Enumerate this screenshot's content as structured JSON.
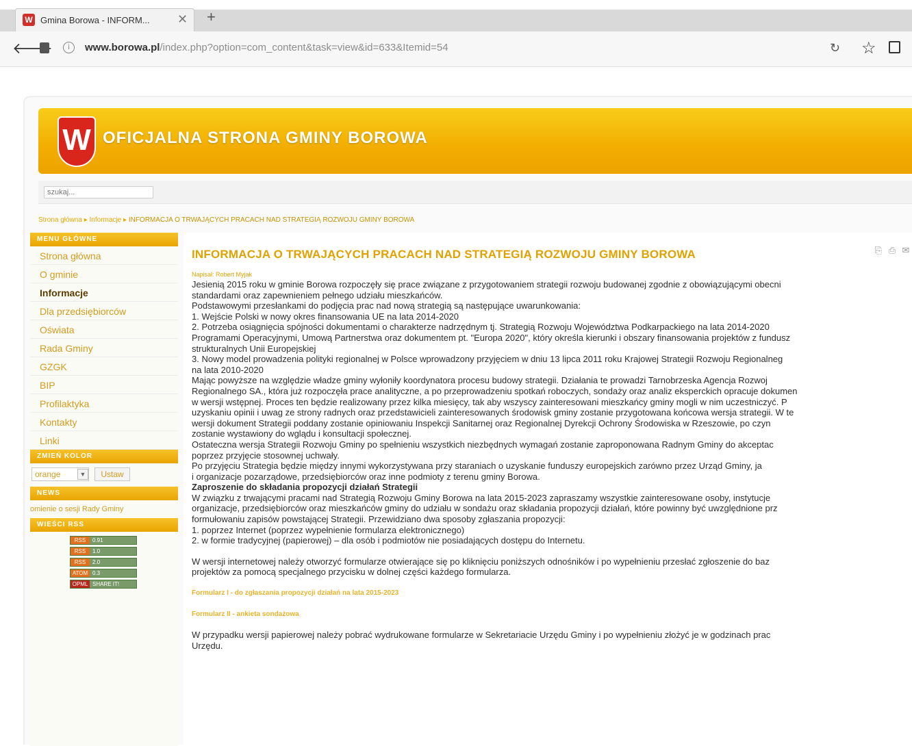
{
  "browser": {
    "tab_title": "Gmina Borowa - INFORM...",
    "url_domain": "www.borowa.pl",
    "url_path": "/index.php?option=com_content&task=view&id=633&Itemid=54",
    "icons": [
      "close-icon",
      "plus-icon",
      "back-arrow-icon",
      "page-icon",
      "info-icon",
      "reload-icon",
      "star-icon",
      "reader-icon"
    ]
  },
  "header": {
    "logo_letter": "W",
    "site_title": "OFICJALNA STRONA GMINY BOROWA",
    "accent_color": "#f2ad00",
    "crest_color": "#d9261c"
  },
  "search": {
    "placeholder": "szukaj..."
  },
  "breadcrumb": {
    "home": "Strona główna",
    "section": "Informacje",
    "current": "INFORMACJA O TRWAJĄCYCH PRACACH NAD STRATEGIĄ ROZWOJU GMINY BOROWA"
  },
  "sidebar": {
    "menu_heading": "MENU GŁÓWNE",
    "menu": [
      "Strona główna",
      "O gminie",
      "Informacje",
      "Dla przedsiębiorców",
      "Oświata",
      "Rada Gminy",
      "GZGK",
      "BIP",
      "Profilaktyka",
      "Kontakty",
      "Linki"
    ],
    "active_item": "Informacje",
    "color_heading": "ZMIEŃ KOLOR",
    "color_value": "orange",
    "color_button": "Ustaw",
    "news_heading": "NEWS",
    "news_link": "omienie o sesji Rady Gminy",
    "rss_heading": "WIEŚCI RSS",
    "rss_badges": [
      {
        "left": "RSS",
        "right": "0.91"
      },
      {
        "left": "RSS",
        "right": "1.0"
      },
      {
        "left": "RSS",
        "right": "2.0"
      },
      {
        "left": "ATOM",
        "right": "0.3"
      },
      {
        "left": "OPML",
        "right": "SHARE IT!"
      }
    ]
  },
  "article": {
    "title": "INFORMACJA O TRWAJĄCYCH PRACACH NAD STRATEGIĄ ROZWOJU GMINY BOROWA",
    "author": "Napisał: Robert Myjak",
    "lines": [
      "Jesienią 2015 roku w gminie Borowa rozpoczęły się prace związane z przygotowaniem strategii rozwoju budowanej zgodnie z obowiązującymi obecni",
      "standardami oraz zapewnieniem pełnego udziału mieszkańców.",
      "Podstawowymi przesłankami do podjęcia prac nad nową strategią są następujące uwarunkowania:",
      "1. Wejście Polski w nowy okres finansowania UE na lata 2014-2020",
      "2. Potrzeba osiągnięcia spójności dokumentami o charakterze nadrzędnym tj. Strategią Rozwoju Województwa Podkarpackiego na lata 2014-2020",
      "Programami Operacyjnymi, Umową Partnerstwa oraz dokumentem pt. \"Europa 2020\", który określa kierunki i obszary finansowania projektów z fundusz",
      "strukturalnych Unii Europejskiej",
      "3. Nowy model prowadzenia polityki regionalnej w Polsce wprowadzony przyjęciem w dniu 13 lipca 2011 roku Krajowej Strategii Rozwoju Regionalneg",
      "na lata 2010-2020",
      "Mając powyższe na względzie władze gminy wyłoniły koordynatora procesu budowy strategii. Działania te prowadzi Tarnobrzeska Agencja Rozwoj",
      "Regionalnego SA., która już rozpoczęła prace analityczne, a po przeprowadzeniu spotkań roboczych, sondaży oraz analiz eksperckich opracuje dokumen",
      "w wersji wstępnej. Proces ten będzie realizowany przez kilka miesięcy, tak aby wszyscy zainteresowani mieszkańcy gminy mogli w nim uczestniczyć. P",
      "uzyskaniu opinii i uwag ze strony radnych oraz przedstawicieli zainteresowanych środowisk gminy zostanie przygotowana końcowa wersja strategii. W te",
      "wersji dokument Strategii poddany zostanie opiniowaniu Inspekcji Sanitarnej oraz Regionalnej Dyrekcji Ochrony Środowiska w Rzeszowie, po czyn",
      "zostanie wystawiony do wglądu i konsultacji społecznej.",
      "Ostateczna wersja Strategii Rozwoju Gminy po spełnieniu wszystkich niezbędnych wymagań zostanie zaproponowana Radnym Gminy do akceptac",
      "poprzez przyjęcie stosownej uchwały.",
      "Po przyjęciu Strategia będzie między innymi wykorzystywana przy staraniach o uzyskanie funduszy europejskich zarówno przez Urząd Gminy, ja",
      "i organizacje pozarządowe, przedsiębiorców oraz inne podmioty z terenu gminy Borowa."
    ],
    "invite_heading": "Zaproszenie do składania propozycji działań Strategii",
    "invite_lines": [
      "W związku z trwającymi pracami nad Strategią Rozwoju Gminy Borowa na lata 2015-2023 zapraszamy wszystkie zainteresowane osoby, instytucje",
      "organizacje, przedsiębiorców oraz mieszkańców gminy do udziału w sondażu oraz składania propozycji działań, które powinny być uwzględnione prz",
      "formułowaniu zapisów powstającej Strategii. Przewidziano dwa sposoby zgłaszania propozycji:",
      "1. poprzez Internet (poprzez wypełnienie formularza elektronicznego)",
      "2. w formie tradycyjnej (papierowej) – dla osób i podmiotów nie posiadających dostępu do Internetu."
    ],
    "online_lines": [
      "W wersji internetowej należy otworzyć formularze otwierające się po kliknięciu poniższych odnośników i po wypełnieniu przesłać zgłoszenie do baz",
      "projektów za pomocą specjalnego przycisku w dolnej części każdego formularza."
    ],
    "form1": "Formularz I - do zgłaszania propozycji działań na lata 2015-2023",
    "form2": "Formularz II - ankieta sondażowa",
    "paper_lines": [
      "W przypadku wersji papierowej należy pobrać wydrukowane formularze w Sekretariacie Urzędu Gminy i po wypełnieniu złożyć je w godzinach prac",
      "Urzędu."
    ]
  }
}
